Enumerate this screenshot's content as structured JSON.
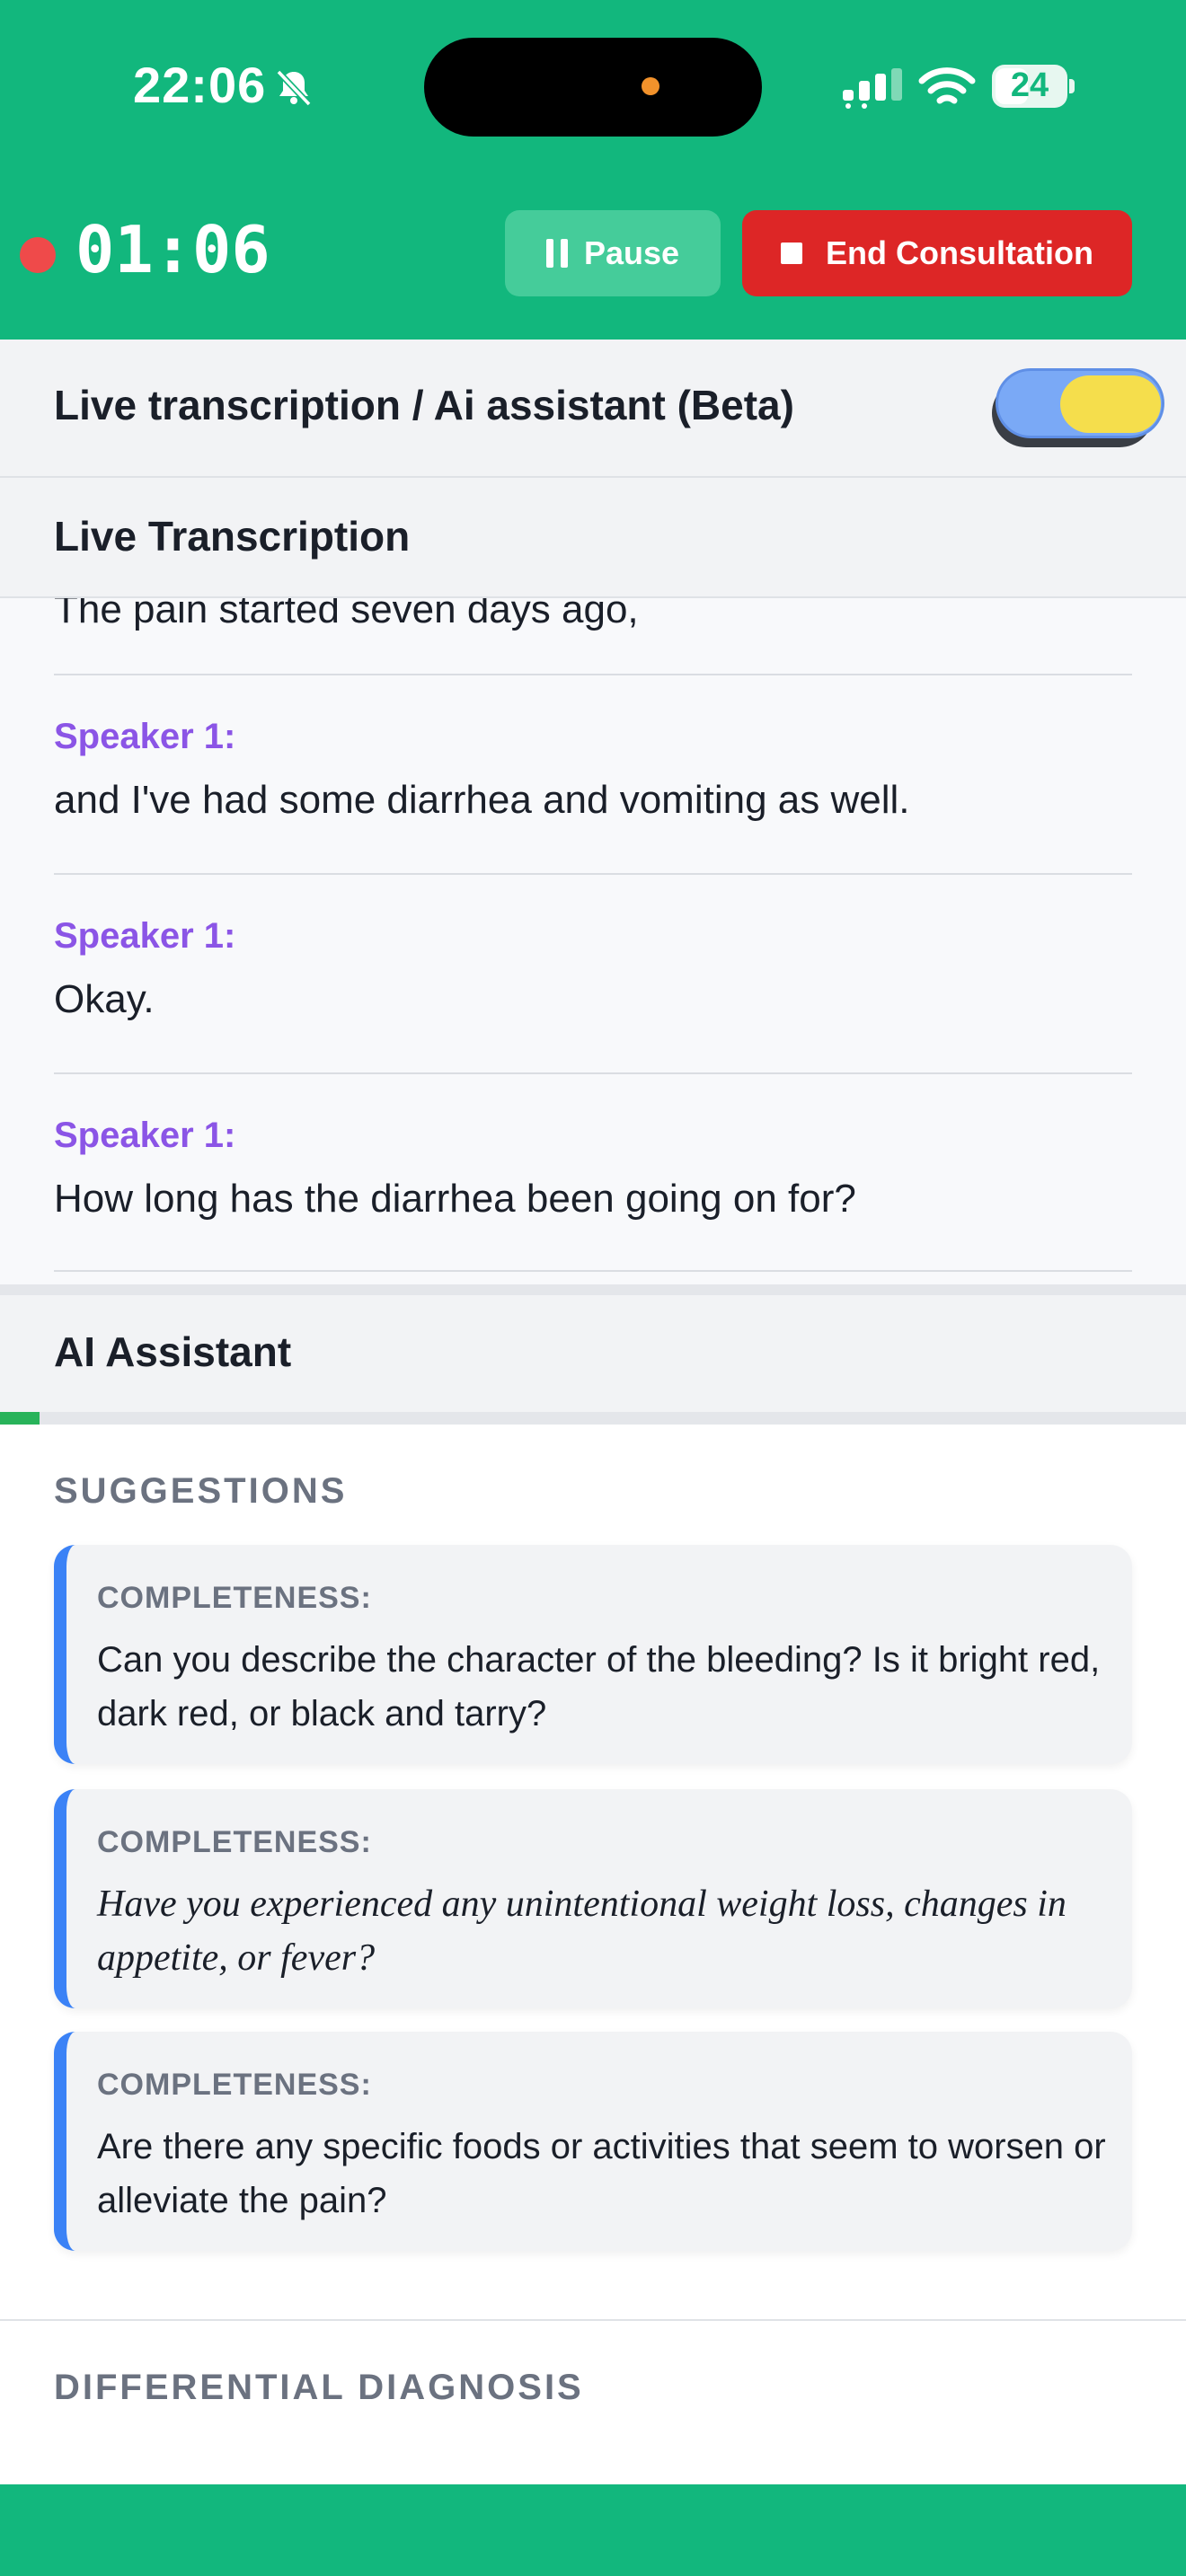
{
  "status_bar": {
    "time": "22:06",
    "battery": "24",
    "icons": [
      "bell-slash-icon",
      "cellular-signal-icon",
      "wifi-icon",
      "battery-icon"
    ]
  },
  "header": {
    "timer": "01:06",
    "pause_label": "Pause",
    "end_label": "End Consultation",
    "colors": {
      "bar": "#12b77d",
      "end_button": "#dd2626",
      "pause_button": "#45cc9a",
      "recording_dot": "#ef4a4a"
    }
  },
  "toggle_row": {
    "label": "Live transcription / Ai assistant (Beta)",
    "enabled": true
  },
  "transcription": {
    "title": "Live Transcription",
    "partial_line": "The pain started seven days ago,",
    "entries": [
      {
        "speaker": "Speaker 1:",
        "text": "and I've had some diarrhea and vomiting as well."
      },
      {
        "speaker": "Speaker 1:",
        "text": "Okay."
      },
      {
        "speaker": "Speaker 1:",
        "text": "How long has the diarrhea been going on for?"
      }
    ]
  },
  "assistant": {
    "title": "AI Assistant",
    "progress": 0.033,
    "suggestions_title": "SUGGESTIONS",
    "suggestions": [
      {
        "label": "COMPLETENESS:",
        "text": "Can you describe the character of the bleeding? Is it bright red, dark red, or black and tarry?"
      },
      {
        "label": "COMPLETENESS:",
        "text": "Have you experienced any unintentional weight loss, changes in appetite, or fever?"
      },
      {
        "label": "COMPLETENESS:",
        "text": "Are there any specific foods or activities that seem to worsen or alleviate the pain?"
      }
    ],
    "differential_title": "DIFFERENTIAL DIAGNOSIS"
  }
}
